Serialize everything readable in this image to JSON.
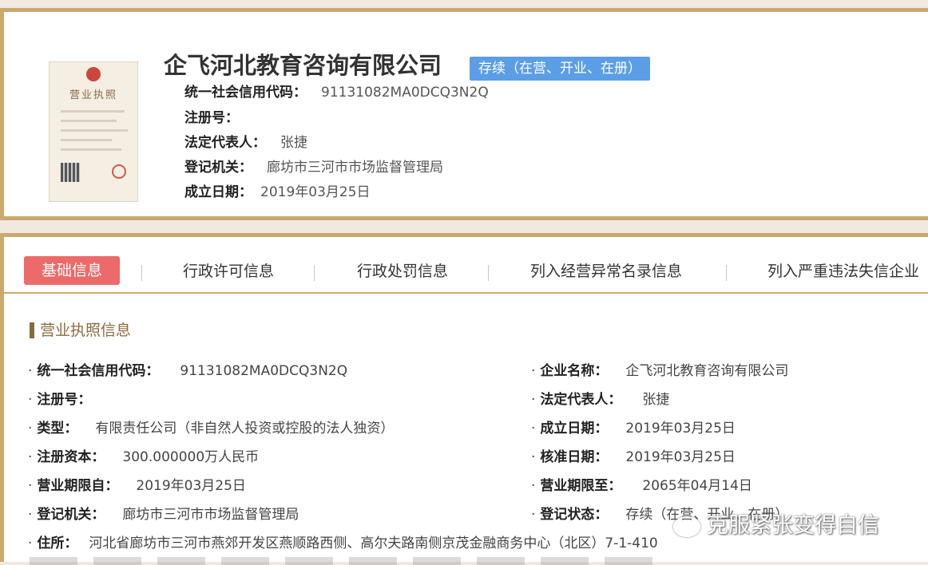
{
  "header": {
    "company_name": "企飞河北教育咨询有限公司",
    "status": "存续（在营、开业、在册）",
    "rows": [
      {
        "label": "统一社会信用代码：",
        "value": "91131082MA0DCQ3N2Q"
      },
      {
        "label": "注册号：",
        "value": ""
      },
      {
        "label": "法定代表人：",
        "value": "张捷"
      },
      {
        "label": "登记机关：",
        "value": "廊坊市三河市市场监督管理局"
      },
      {
        "label": "成立日期：",
        "value": "2019年03月25日"
      }
    ],
    "license_title": "营业执照"
  },
  "tabs": [
    "基础信息",
    "行政许可信息",
    "行政处罚信息",
    "列入经营异常名录信息",
    "列入严重违法失信企业"
  ],
  "section": {
    "title": "营业执照信息",
    "left": [
      {
        "label": "统一社会信用代码：",
        "value": "91131082MA0DCQ3N2Q"
      },
      {
        "label": "注册号：",
        "value": ""
      },
      {
        "label": "类型：",
        "value": "有限责任公司（非自然人投资或控股的法人独资）"
      },
      {
        "label": "注册资本：",
        "value": "300.000000万人民币"
      },
      {
        "label": "营业期限自：",
        "value": "2019年03月25日"
      },
      {
        "label": "登记机关：",
        "value": "廊坊市三河市市场监督管理局"
      }
    ],
    "right": [
      {
        "label": "企业名称：",
        "value": "企飞河北教育咨询有限公司"
      },
      {
        "label": "法定代表人：",
        "value": "张捷"
      },
      {
        "label": "成立日期：",
        "value": "2019年03月25日"
      },
      {
        "label": "核准日期：",
        "value": "2019年03月25日"
      },
      {
        "label": "营业期限至：",
        "value": "2065年04月14日"
      },
      {
        "label": "登记状态：",
        "value": "存续（在营、开业、在册）"
      }
    ],
    "address": {
      "label": "住所：",
      "value": "河北省廊坊市三河市燕郊开发区燕顺路西侧、高尔夫路南侧京茂金融商务中心（北区）7-1-410"
    }
  },
  "watermark": "克服紧张变得自信"
}
